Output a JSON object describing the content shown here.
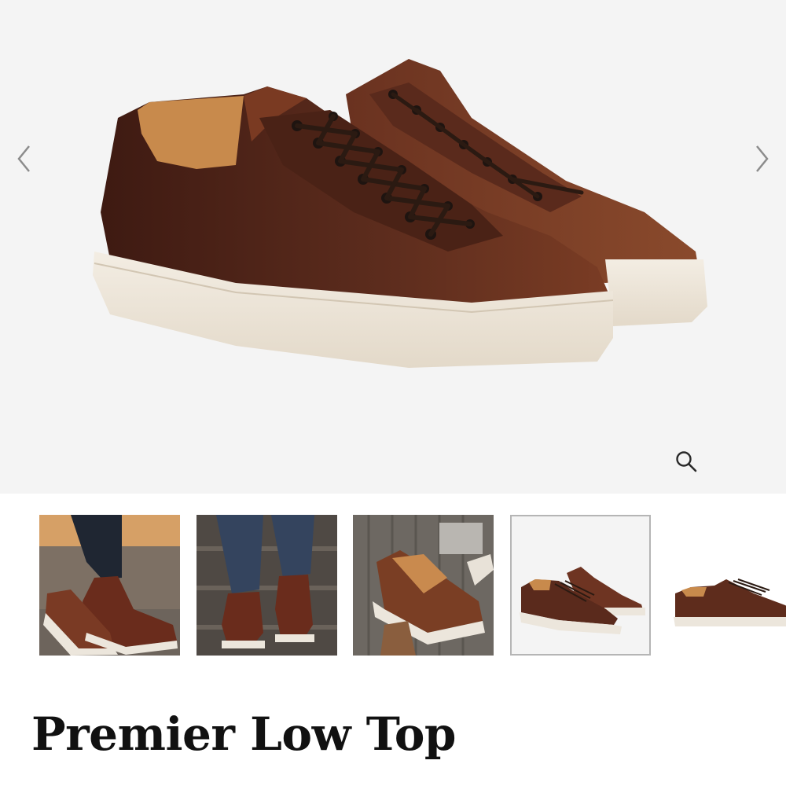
{
  "product": {
    "title": "Premier Low Top"
  },
  "gallery": {
    "prev_icon": "chevron-left-icon",
    "next_icon": "chevron-right-icon",
    "zoom_icon": "magnifier-icon",
    "thumbnails": [
      {
        "name": "thumbnail-1",
        "selected": false
      },
      {
        "name": "thumbnail-2",
        "selected": false
      },
      {
        "name": "thumbnail-3",
        "selected": false
      },
      {
        "name": "thumbnail-4",
        "selected": true
      },
      {
        "name": "thumbnail-5",
        "selected": false
      }
    ]
  },
  "colors": {
    "background": "#f4f4f4",
    "leather": "#5a2a1c",
    "sole": "#efe7da",
    "title": "#111111"
  }
}
